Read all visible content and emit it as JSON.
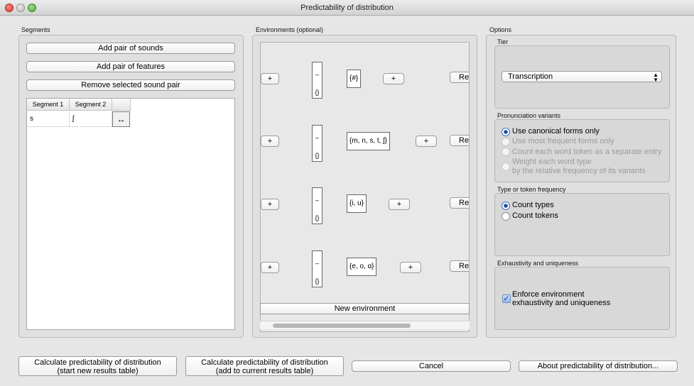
{
  "window": {
    "title": "Predictability of distribution"
  },
  "segments": {
    "label": "Segments",
    "add_pair_sounds": "Add pair of sounds",
    "add_pair_features": "Add pair of features",
    "remove_pair": "Remove selected sound pair",
    "columns": [
      "Segment 1",
      "Segment 2"
    ],
    "rows": [
      {
        "seg1": "s",
        "seg2": "ʃ",
        "swap": "↔"
      }
    ]
  },
  "environments": {
    "label": "Environments (optional)",
    "items": [
      {
        "left_plus": "+",
        "dash": "–",
        "brace": "{}",
        "set": "{#}",
        "right_plus": "+",
        "remove": "Rer"
      },
      {
        "left_plus": "+",
        "dash": "–",
        "brace": "{}",
        "set": "{m, n, s, t, ʃ}",
        "right_plus": "+",
        "remove": "Rer"
      },
      {
        "left_plus": "+",
        "dash": "–",
        "brace": "{}",
        "set": "{i, u}",
        "right_plus": "+",
        "remove": "Rer"
      },
      {
        "left_plus": "+",
        "dash": "–",
        "brace": "{}",
        "set": "{e, o, ɑ}",
        "right_plus": "+",
        "remove": "Rer"
      }
    ],
    "new_environment": "New environment"
  },
  "options": {
    "label": "Options",
    "tier": {
      "label": "Tier",
      "value": "Transcription"
    },
    "pronunciation": {
      "label": "Pronunciation variants",
      "choices": [
        "Use canonical forms only",
        "Use most frequent forms only",
        "Count each word token as a separate entry",
        "Weight each word type",
        "by the relative frequency of its variants"
      ]
    },
    "frequency": {
      "label": "Type or token frequency",
      "types": "Count types",
      "tokens": "Count tokens"
    },
    "exhaustivity": {
      "label": "Exhaustivity and uniqueness",
      "line1": "Enforce environment",
      "line2": "exhaustivity and uniqueness"
    }
  },
  "footer": {
    "calc_new_1": "Calculate predictability of distribution",
    "calc_new_2": "(start new results table)",
    "calc_add_1": "Calculate predictability of distribution",
    "calc_add_2": "(add to current results table)",
    "cancel": "Cancel",
    "about": "About predictability of distribution..."
  }
}
